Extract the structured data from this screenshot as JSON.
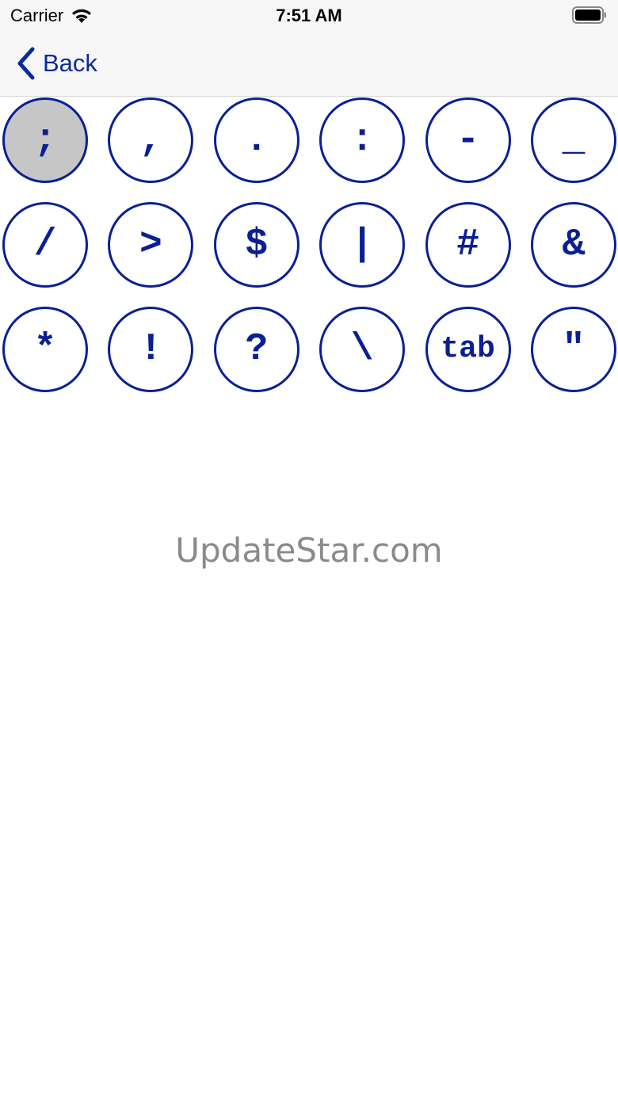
{
  "status_bar": {
    "carrier": "Carrier",
    "time": "7:51 AM",
    "wifi_icon": "wifi-icon",
    "battery_icon": "battery-full-icon"
  },
  "nav": {
    "back_label": "Back",
    "back_icon": "chevron-left-icon"
  },
  "colors": {
    "accent": "#0a1f94",
    "selected_key_bg": "#c6c6c6",
    "bar_bg": "#f7f7f7",
    "watermark": "#8a8a8a"
  },
  "keypad": {
    "selected_index": 0,
    "keys": [
      ";",
      ",",
      ".",
      ":",
      "-",
      "_",
      "/",
      ">",
      "$",
      "|",
      "#",
      "&",
      "*",
      "!",
      "?",
      "\\",
      "tab",
      "\""
    ]
  },
  "watermark": "UpdateStar.com"
}
